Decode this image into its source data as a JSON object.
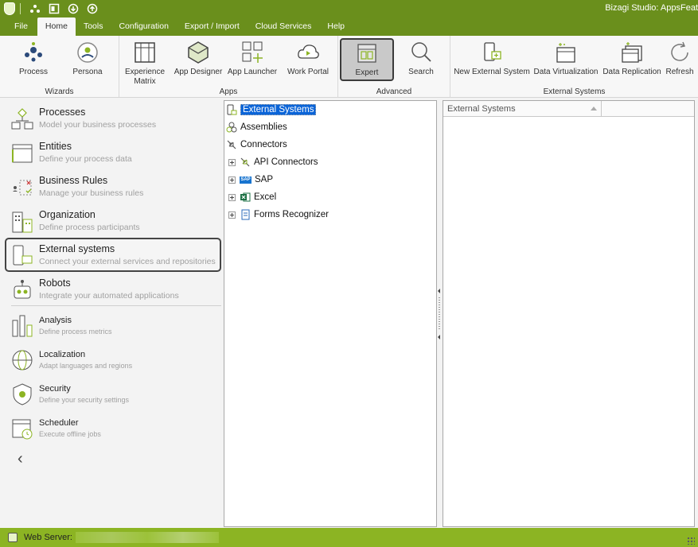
{
  "window": {
    "title": "Bizagi Studio: AppsFeat"
  },
  "menu": {
    "tabs": [
      {
        "label": "File"
      },
      {
        "label": "Home"
      },
      {
        "label": "Tools"
      },
      {
        "label": "Configuration"
      },
      {
        "label": "Export / Import"
      },
      {
        "label": "Cloud Services"
      },
      {
        "label": "Help"
      }
    ],
    "active": "Home"
  },
  "ribbon": {
    "groups": {
      "wizards": "Wizards",
      "apps": "Apps",
      "advanced": "Advanced",
      "external_systems": "External Systems"
    },
    "buttons": {
      "process": "Process",
      "persona": "Persona",
      "experience_matrix": "Experience Matrix",
      "app_designer": "App Designer",
      "app_launcher": "App Launcher",
      "work_portal": "Work Portal",
      "expert": "Expert",
      "search": "Search",
      "new_external_system": "New External System",
      "data_virtualization": "Data Virtualization",
      "data_replication": "Data Replication",
      "refresh": "Refresh"
    }
  },
  "nav": {
    "items": [
      {
        "title": "Processes",
        "desc": "Model your business processes",
        "icon": "processes-icon"
      },
      {
        "title": "Entities",
        "desc": "Define your process data",
        "icon": "entities-icon"
      },
      {
        "title": "Business Rules",
        "desc": "Manage your business rules",
        "icon": "business-rules-icon"
      },
      {
        "title": "Organization",
        "desc": "Define process participants",
        "icon": "organization-icon"
      },
      {
        "title": "External systems",
        "desc": "Connect your external services and repositories",
        "icon": "external-systems-icon"
      },
      {
        "title": "Robots",
        "desc": "Integrate your automated applications",
        "icon": "robots-icon"
      },
      {
        "title": "Analysis",
        "desc": "Define process metrics",
        "icon": "analysis-icon"
      },
      {
        "title": "Localization",
        "desc": "Adapt languages and regions",
        "icon": "localization-icon"
      },
      {
        "title": "Security",
        "desc": "Define your security settings",
        "icon": "security-icon"
      },
      {
        "title": "Scheduler",
        "desc": "Execute offline jobs",
        "icon": "scheduler-icon"
      }
    ],
    "selected": "External systems",
    "collapse_glyph": "‹"
  },
  "tree": {
    "root": "External Systems",
    "assemblies": "Assemblies",
    "connectors": "Connectors",
    "children": [
      {
        "label": "API Connectors"
      },
      {
        "label": "SAP"
      },
      {
        "label": "Excel"
      },
      {
        "label": "Forms Recognizer"
      }
    ],
    "sap_badge": "SAP"
  },
  "grid": {
    "header": "External Systems"
  },
  "status": {
    "label": "Web Server:"
  },
  "colors": {
    "brand": "#6a8f1c",
    "status": "#8cb423",
    "selection": "#0a64d8"
  }
}
